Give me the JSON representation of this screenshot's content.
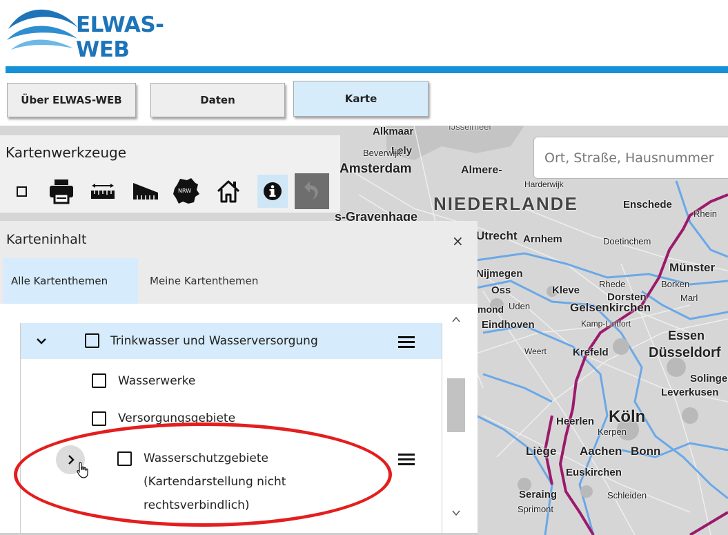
{
  "header": {
    "logo_text": "ELWAS-WEB"
  },
  "nav": {
    "about_label": "Über ELWAS-WEB",
    "data_label": "Daten",
    "map_label": "Karte",
    "active": "Karte"
  },
  "map": {
    "search_placeholder": "Ort, Straße, Hausnummer",
    "labels": {
      "alkmaar": "Alkmaar",
      "ijsselmeer": "IJsselmeer",
      "lely": "Lely",
      "beverwijk": "Beverwijk",
      "amsterdam": "Amsterdam",
      "almere": "Almere-",
      "harderwijk": "Harderwijk",
      "niederlande": "NIEDERLANDE",
      "enschede": "Enschede",
      "rhein": "Rhein",
      "gravenhage": "s-Gravenhage",
      "utrecht": "Utrecht",
      "arnhem": "Arnhem",
      "doetinchem": "Doetinchem",
      "muenster": "Münster",
      "nijmegen": "Nijmegen",
      "rhede": "Rhede",
      "borken": "Borken",
      "oss": "Oss",
      "kleve": "Kleve",
      "dorsten": "Dorsten",
      "marl": "Marl",
      "uden": "Uden",
      "gelsenkirchen": "Gelsenkirchen",
      "mond": "mond",
      "eindhoven": "Eindhoven",
      "kamp_lintfort": "Kamp-Lintfort",
      "essen": "Essen",
      "weert": "Weert",
      "krefeld": "Krefeld",
      "duesseldorf": "Düsseldorf",
      "solingen": "Solingen",
      "leverkusen": "Leverkusen",
      "heerlen": "Heerlen",
      "koeln": "Köln",
      "kerpen": "Kerpen",
      "liege": "Liège",
      "aachen": "Aachen",
      "bonn": "Bonn",
      "euskirchen": "Euskirchen",
      "seraing": "Seraing",
      "schleiden": "Schleiden",
      "sprimont": "Sprimont"
    }
  },
  "tools_panel": {
    "title": "Kartenwerkzeuge",
    "icons": [
      "checkbox-icon",
      "printer-icon",
      "ruler-icon",
      "area-ruler-icon",
      "nrw-icon",
      "home-icon",
      "info-icon",
      "undo-icon"
    ],
    "nrw_text": "NRW"
  },
  "content_panel": {
    "title": "Karteninhalt",
    "close": "×",
    "tabs": [
      "Alle Kartenthemen",
      "Meine Kartenthemen"
    ],
    "active_tab": "Alle Kartenthemen",
    "group": {
      "label": "Trinkwasser und Wasserversorgung",
      "expanded": true,
      "checked": false
    },
    "items": [
      {
        "label": "Wasserwerke",
        "checked": false
      },
      {
        "label": "Versorgungsgebiete",
        "checked": false
      },
      {
        "label_line1": "Wasserschutzgebiete",
        "label_line2": "(Kartendarstellung nicht",
        "label_line3": "rechtsverbindlich)",
        "checked": false,
        "expandable": true
      }
    ]
  },
  "colors": {
    "accent": "#1592d7",
    "brand": "#1e74b8",
    "highlight": "#e41e1e",
    "active_tab": "#d6ebfb"
  }
}
